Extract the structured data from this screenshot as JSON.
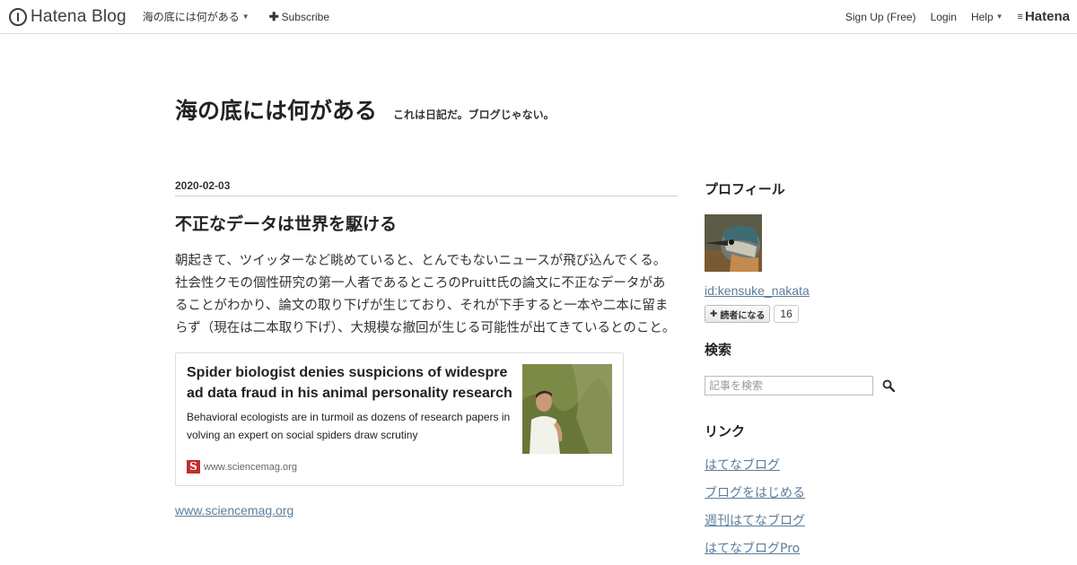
{
  "global_header": {
    "logo_text": "Hatena Blog",
    "blog_menu_label": "海の底には何がある",
    "subscribe_label": "Subscribe",
    "signup_label": "Sign Up (Free)",
    "login_label": "Login",
    "help_label": "Help",
    "hatena_label": "Hatena"
  },
  "blog": {
    "title": "海の底には何がある",
    "description": "これは日記だ。ブログじゃない。"
  },
  "entry": {
    "date": "2020-02-03",
    "title": "不正なデータは世界を駆ける",
    "body": "朝起きて、ツイッターなど眺めていると、とんでもないニュースが飛び込んでくる。社会性クモの個性研究の第一人者であるところのPruitt氏の論文に不正なデータがあることがわかり、論文の取り下げが生じており、それが下手すると一本や二本に留まらず（現在は二本取り下げ）、大規模な撤回が生じる可能性が出てきているとのこと。",
    "embed": {
      "title": "Spider biologist denies suspicions of widespread data fraud in his animal personality research",
      "description": "Behavioral ecologists are in turmoil as dozens of research papers involving an expert on social spiders draw scrutiny",
      "site": "www.sciencemag.org",
      "favicon_letter": "S"
    },
    "link_text": "www.sciencemag.org"
  },
  "sidebar": {
    "profile_heading": "プロフィール",
    "profile_id": "id:kensuke_nakata",
    "subscribe_button": "読者になる",
    "subscriber_count": "16",
    "search_heading": "検索",
    "search_placeholder": "記事を検索",
    "links_heading": "リンク",
    "links": [
      "はてなブログ",
      "ブログをはじめる",
      "週刊はてなブログ",
      "はてなブログPro"
    ]
  }
}
